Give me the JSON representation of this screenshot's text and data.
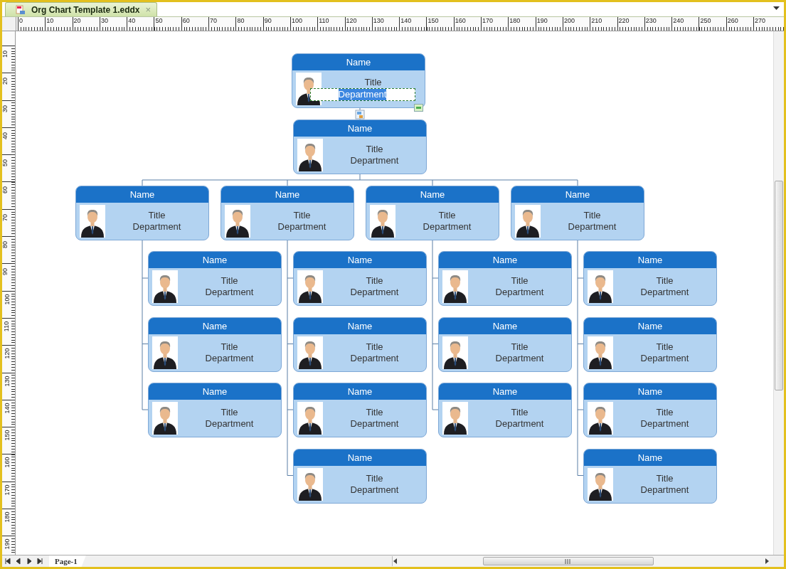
{
  "document_tab": {
    "title": "Org Chart Template 1.eddx",
    "close": "×",
    "selected": true
  },
  "top_ruler": [
    "0",
    "10",
    "20",
    "30",
    "40",
    "50",
    "60",
    "70",
    "80",
    "90",
    "100",
    "110",
    "120",
    "130",
    "140",
    "150",
    "160",
    "170",
    "180",
    "190",
    "200",
    "210",
    "220",
    "230",
    "240",
    "250",
    "260",
    "270"
  ],
  "left_ruler": [
    "10",
    "20",
    "30",
    "40",
    "50",
    "60",
    "70",
    "80",
    "90",
    "100",
    "110",
    "120",
    "130",
    "140",
    "150",
    "160",
    "170",
    "180",
    "190"
  ],
  "assistant_card": {
    "name": "Name",
    "title": "Title",
    "department": "Department",
    "editing": true
  },
  "org_chart": {
    "name": "Name",
    "title": "Title",
    "department": "Department",
    "children": [
      {
        "name": "Name",
        "title": "Title",
        "department": "Department",
        "children": [
          {
            "name": "Name",
            "title": "Title",
            "department": "Department"
          },
          {
            "name": "Name",
            "title": "Title",
            "department": "Department"
          },
          {
            "name": "Name",
            "title": "Title",
            "department": "Department"
          }
        ]
      },
      {
        "name": "Name",
        "title": "Title",
        "department": "Department",
        "children": [
          {
            "name": "Name",
            "title": "Title",
            "department": "Department"
          },
          {
            "name": "Name",
            "title": "Title",
            "department": "Department"
          },
          {
            "name": "Name",
            "title": "Title",
            "department": "Department"
          },
          {
            "name": "Name",
            "title": "Title",
            "department": "Department"
          }
        ]
      },
      {
        "name": "Name",
        "title": "Title",
        "department": "Department",
        "children": [
          {
            "name": "Name",
            "title": "Title",
            "department": "Department"
          },
          {
            "name": "Name",
            "title": "Title",
            "department": "Department"
          },
          {
            "name": "Name",
            "title": "Title",
            "department": "Department"
          }
        ]
      },
      {
        "name": "Name",
        "title": "Title",
        "department": "Department",
        "children": [
          {
            "name": "Name",
            "title": "Title",
            "department": "Department"
          },
          {
            "name": "Name",
            "title": "Title",
            "department": "Department"
          },
          {
            "name": "Name",
            "title": "Title",
            "department": "Department"
          },
          {
            "name": "Name",
            "title": "Title",
            "department": "Department"
          }
        ]
      }
    ]
  },
  "page_tabs": [
    {
      "label": "Page-1",
      "selected": true
    }
  ]
}
